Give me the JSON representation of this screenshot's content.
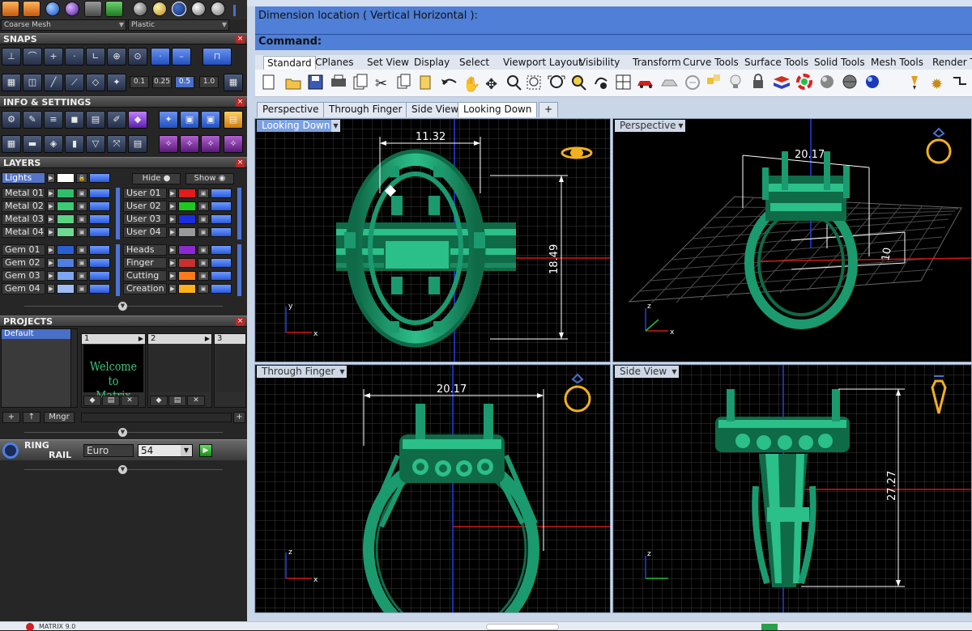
{
  "left_panel": {
    "mesh_dropdown": "Coarse Mesh",
    "material_dropdown": "Plastic",
    "sections": {
      "snaps": "SNAPS",
      "info_settings": "INFO & SETTINGS",
      "layers": "LAYERS",
      "projects": "PROJECTS"
    },
    "close_glyph": "×",
    "snap_values": [
      "0.1",
      "0.25",
      "0.5",
      "1.0"
    ],
    "lights_label": "Lights",
    "hide_label": "Hide",
    "show_label": "Show",
    "layers_left": [
      {
        "name": "Metal 01",
        "color": "#2fbf6a"
      },
      {
        "name": "Metal 02",
        "color": "#3ccb74"
      },
      {
        "name": "Metal 03",
        "color": "#59d483"
      },
      {
        "name": "Metal 04",
        "color": "#6ed993"
      },
      {
        "name": "Gem 01",
        "color": "#2a5fd0"
      },
      {
        "name": "Gem 02",
        "color": "#4f7fe0"
      },
      {
        "name": "Gem 03",
        "color": "#7ea6f0"
      },
      {
        "name": "Gem 04",
        "color": "#9fbdf4"
      }
    ],
    "layers_right": [
      {
        "name": "User 01",
        "color": "#e01c1c"
      },
      {
        "name": "User 02",
        "color": "#1ec81e"
      },
      {
        "name": "User 03",
        "color": "#1c2de0"
      },
      {
        "name": "User 04",
        "color": "#9a9a9a"
      },
      {
        "name": "Heads",
        "color": "#8a2ad0"
      },
      {
        "name": "Finger",
        "color": "#c83030"
      },
      {
        "name": "Cutting",
        "color": "#ff7a1a"
      },
      {
        "name": "Creation",
        "color": "#ffb21a"
      }
    ],
    "projects": {
      "default_item": "Default",
      "slots": [
        "1",
        "2",
        "3"
      ],
      "welcome_text": [
        "Welcome to",
        "Matrix"
      ],
      "manager_label": "Mngr",
      "add_glyph": "+",
      "up_glyph": "↑"
    },
    "ring_rail": {
      "label_line1": "RING",
      "label_line2": "RAIL",
      "standard": "Euro",
      "size": "54"
    }
  },
  "right_area": {
    "command": {
      "prompt_line": "Dimension location ( Vertical  Horizontal ):",
      "command_label": "Command:"
    },
    "toolbar_tabs": [
      "Standard",
      "CPlanes",
      "Set View",
      "Display",
      "Select",
      "Viewport Layout",
      "Visibility",
      "Transform",
      "Curve Tools",
      "Surface Tools",
      "Solid Tools",
      "Mesh Tools",
      "Render Tools"
    ],
    "viewport_tabs": [
      "Perspective",
      "Through Finger",
      "Side View",
      "Looking Down"
    ],
    "viewport_tab_add": "+",
    "viewports": {
      "looking_down": {
        "label": "Looking Down",
        "dim_width": "11.32",
        "dim_height": "18.49"
      },
      "perspective": {
        "label": "Perspective",
        "dim_width": "20.17",
        "dim_depth": "10"
      },
      "through_finger": {
        "label": "Through Finger",
        "dim_width": "20.17"
      },
      "side_view": {
        "label": "Side View",
        "dim_height": "27.27"
      }
    },
    "axis_labels": {
      "x": "x",
      "y": "y",
      "z": "z"
    }
  },
  "taskbar": {
    "item_text": "MATRIX 9.0"
  },
  "colors": {
    "ring_green": "#1a9a6e",
    "command_blue": "#4f7fd6",
    "axis_red": "#d01818",
    "axis_blue": "#2040e0",
    "gold_icon": "#f0b020"
  }
}
